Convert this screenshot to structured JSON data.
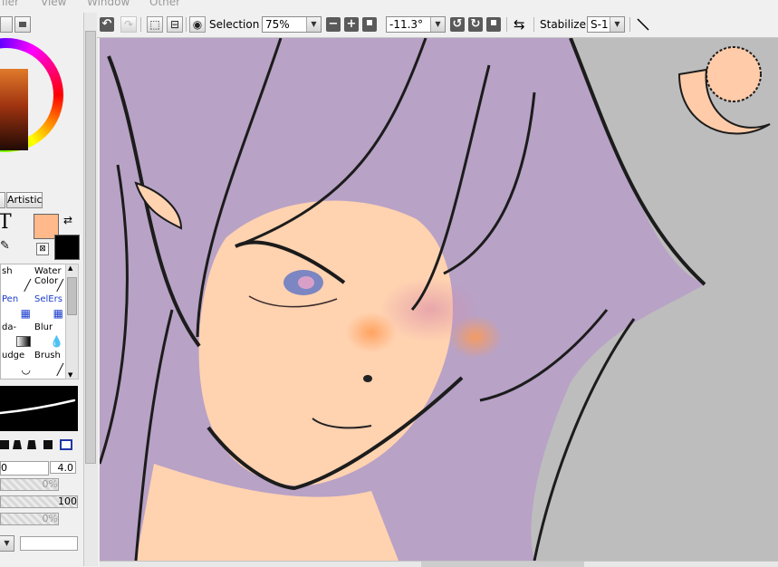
{
  "menu": {
    "items": [
      "iler",
      "View",
      "Window",
      "Other"
    ]
  },
  "left_panel": {
    "artistic_label": "Artistic",
    "text_tool_glyph": "T",
    "brushes": [
      {
        "label": "sh",
        "icon": "brush-icon"
      },
      {
        "label": "Water Color",
        "icon": "watercolor-brush-icon"
      },
      {
        "label": "Pen",
        "icon": "pen-icon"
      },
      {
        "label": "SelErs",
        "icon": "selection-eraser-icon"
      },
      {
        "label": "da-",
        "icon": "gradation-icon"
      },
      {
        "label": "Blur",
        "icon": "blur-drop-icon"
      },
      {
        "label": "udge",
        "icon": "smudge-icon"
      },
      {
        "label": "Brush",
        "icon": "brush-icon"
      }
    ],
    "size_value": "0",
    "size_max": "4.0",
    "min_size_pct": "0%",
    "density": "100",
    "blend_pct": "0%",
    "primary_color": "#ffb98a",
    "secondary_color": "#000000"
  },
  "toolbar": {
    "selection_label": "Selection",
    "zoom": "75%",
    "rotation": "-11.3°",
    "stabilizer_label": "Stabilizer",
    "stabilizer_value": "S-1"
  },
  "canvas": {
    "background_color": "#bdbdbd",
    "hair_color": "#b8a2c6",
    "skin_color": "#ffd2b0",
    "accent_color": "#ffb98a"
  }
}
